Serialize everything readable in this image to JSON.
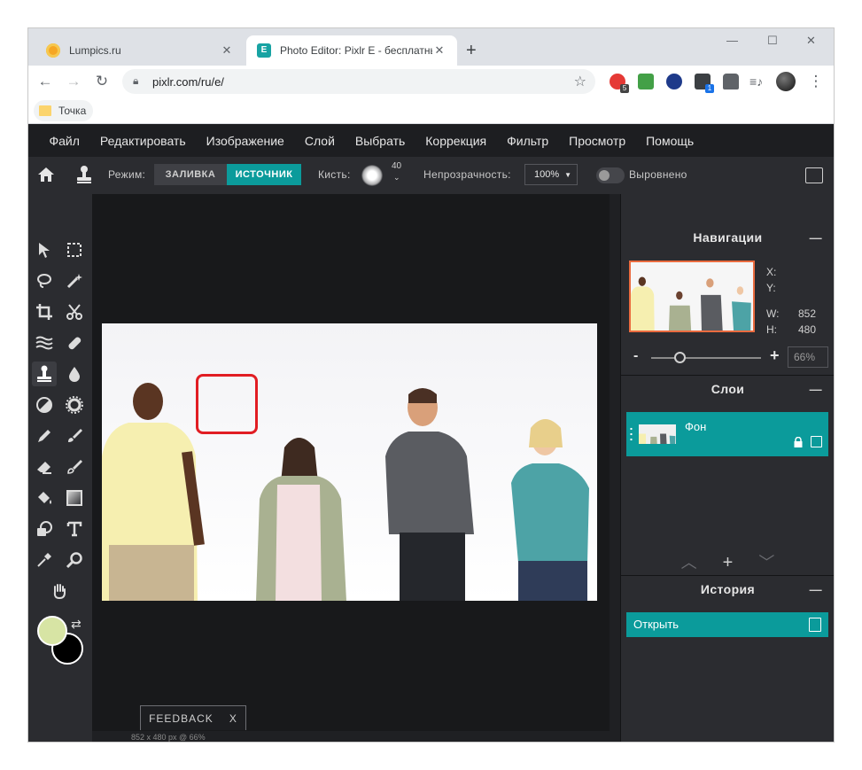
{
  "browser": {
    "tabs": [
      {
        "title": "Lumpics.ru",
        "active": false
      },
      {
        "title": "Photo Editor: Pixlr E - бесплатны",
        "active": true
      }
    ],
    "new_tab": "+",
    "url": "pixlr.com/ru/e/",
    "bookmark": "Точка",
    "extension_badges": {
      "first": "5",
      "cube": "1"
    }
  },
  "menu": [
    "Файл",
    "Редактировать",
    "Изображение",
    "Слой",
    "Выбрать",
    "Коррекция",
    "Фильтр",
    "Просмотр",
    "Помощь"
  ],
  "options": {
    "mode_label": "Режим:",
    "mode_fill": "ЗАЛИВКА",
    "mode_source": "ИСТОЧНИК",
    "brush_label": "Кисть:",
    "brush_size": "40",
    "opacity_label": "Непрозрачность:",
    "opacity_value": "100%",
    "aligned_label": "Выровнено",
    "aligned_on": false
  },
  "canvas": {
    "status": "852 x 480 px @ 66%",
    "feedback_label": "FEEDBACK",
    "feedback_close": "X"
  },
  "navigator": {
    "title": "Навигации",
    "x_label": "X:",
    "y_label": "Y:",
    "x_value": "",
    "y_value": "",
    "w_label": "W:",
    "w_value": "852",
    "h_label": "H:",
    "h_value": "480",
    "zoom_minus": "-",
    "zoom_plus": "+",
    "zoom_value": "66%"
  },
  "layers": {
    "title": "Слои",
    "items": [
      {
        "name": "Фон"
      }
    ]
  },
  "history": {
    "title": "История",
    "items": [
      {
        "name": "Открыть"
      }
    ]
  },
  "colors": {
    "accent": "#0b9b9b",
    "foreground_swatch": "#d7e4a4",
    "background_swatch": "#000000",
    "highlight_rect": "#e11d23"
  }
}
